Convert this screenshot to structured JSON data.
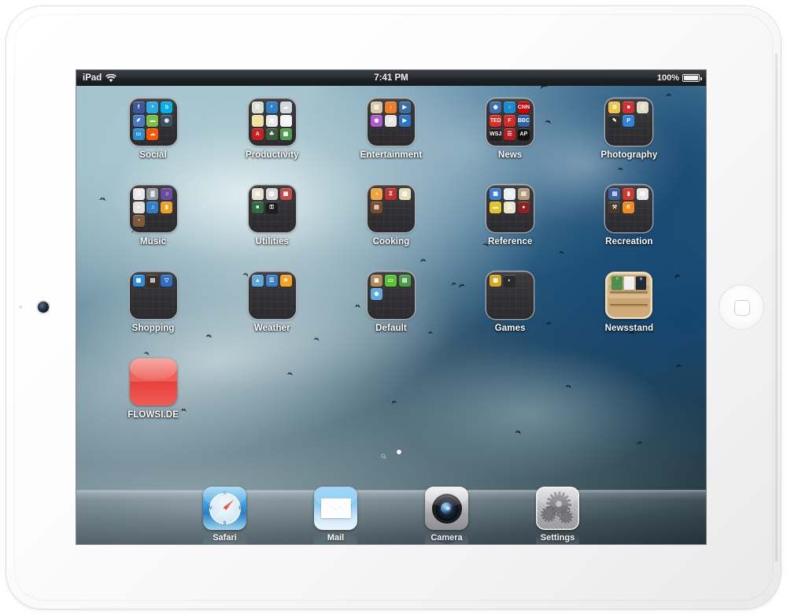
{
  "device": {
    "name": "iPad",
    "body_color": "#f7f7f8",
    "home_button": "home-button",
    "front_camera": "front-camera"
  },
  "status_bar": {
    "carrier": "iPad",
    "wifi_icon": "wifi-icon",
    "time": "7:41 PM",
    "battery_percent": "100%",
    "battery_icon": "battery-icon"
  },
  "home_screen": {
    "wallpaper_description": "sky-with-clouds-and-birds",
    "page_indicator": {
      "search_icon": "search-icon",
      "dots": 1,
      "active_index": 0
    },
    "apps": [
      {
        "label": "Social",
        "type": "folder",
        "mini_icons": [
          {
            "name": "facebook",
            "color": "#3b5998",
            "glyph": "f"
          },
          {
            "name": "twitter",
            "color": "#2daae1",
            "glyph": "ᵛ"
          },
          {
            "name": "skype",
            "color": "#00aff0",
            "glyph": "S"
          },
          {
            "name": "flipboard-social",
            "color": "#4a79c4",
            "glyph": "✐"
          },
          {
            "name": "whatsapp",
            "color": "#7ac043",
            "glyph": "▬"
          },
          {
            "name": "instagram",
            "color": "#3e5266",
            "glyph": "◉"
          },
          {
            "name": "linkedin",
            "color": "#2d8fd0",
            "glyph": "▭"
          },
          {
            "name": "soundcloud",
            "color": "#ff5500",
            "glyph": "☁"
          }
        ]
      },
      {
        "label": "Productivity",
        "type": "folder",
        "mini_icons": [
          {
            "name": "notes-green",
            "color": "#d8dfd2",
            "glyph": "☰"
          },
          {
            "name": "tweetbot",
            "color": "#2f7fc9",
            "glyph": "ᵛ"
          },
          {
            "name": "dropbox",
            "color": "#cfd8dd",
            "glyph": "☁"
          },
          {
            "name": "notepad-yellow",
            "color": "#f2e2a0",
            "glyph": ""
          },
          {
            "name": "pages",
            "color": "#e8e8e8",
            "glyph": "▤"
          },
          {
            "name": "calendar",
            "color": "#f4f4f4",
            "glyph": "3"
          },
          {
            "name": "adobe-reader",
            "color": "#cc1f1f",
            "glyph": "A"
          },
          {
            "name": "evernote",
            "color": "#3b5c3b",
            "glyph": "☘"
          },
          {
            "name": "numbers",
            "color": "#4f9e4f",
            "glyph": "▦"
          }
        ]
      },
      {
        "label": "Entertainment",
        "type": "folder",
        "mini_icons": [
          {
            "name": "tv-remote",
            "color": "#d5c9a5",
            "glyph": "▤"
          },
          {
            "name": "music-orange",
            "color": "#f07c28",
            "glyph": "♪"
          },
          {
            "name": "video-blue",
            "color": "#3d6f9e",
            "glyph": "▶"
          },
          {
            "name": "podcasts-purple",
            "color": "#b05ad0",
            "glyph": "◉"
          },
          {
            "name": "pandora",
            "color": "#e6e6e6",
            "glyph": "P"
          },
          {
            "name": "player-blue",
            "color": "#2c74c4",
            "glyph": "▶"
          }
        ]
      },
      {
        "label": "News",
        "type": "folder",
        "mini_icons": [
          {
            "name": "reeder",
            "color": "#3b6fa8",
            "glyph": "◉"
          },
          {
            "name": "instapaper",
            "color": "#1a8ad0",
            "glyph": "○"
          },
          {
            "name": "cnn",
            "color": "#cc0000",
            "glyph": "CNN"
          },
          {
            "name": "ted",
            "color": "#e62b1e",
            "glyph": "TED"
          },
          {
            "name": "flipboard",
            "color": "#d62a23",
            "glyph": "F"
          },
          {
            "name": "bbc-news",
            "color": "#2b62a8",
            "glyph": "BBC"
          },
          {
            "name": "wall-street-journal",
            "color": "#1f1f1f",
            "glyph": "WSJ"
          },
          {
            "name": "bbc-red",
            "color": "#b81b1b",
            "glyph": "☰"
          },
          {
            "name": "associated-press",
            "color": "#111111",
            "glyph": "AP"
          }
        ]
      },
      {
        "label": "Photography",
        "type": "folder",
        "mini_icons": [
          {
            "name": "camera-flower",
            "color": "#f0c14b",
            "glyph": "✿"
          },
          {
            "name": "photo-red",
            "color": "#d03030",
            "glyph": "■"
          },
          {
            "name": "color-splash",
            "color": "#e0dcc4",
            "glyph": "▒"
          },
          {
            "name": "snapseed",
            "color": "#2e2e2e",
            "glyph": "✎"
          },
          {
            "name": "photogene",
            "color": "#2f83d8",
            "glyph": "P"
          }
        ]
      },
      {
        "label": "Music",
        "type": "folder",
        "mini_icons": [
          {
            "name": "piano-keys",
            "color": "#e9e9e9",
            "glyph": "☰"
          },
          {
            "name": "synth-dark",
            "color": "#8f9aa5",
            "glyph": "▓"
          },
          {
            "name": "garageband-purple",
            "color": "#6b4b9e",
            "glyph": "♫"
          },
          {
            "name": "drum-white",
            "color": "#e0e0dc",
            "glyph": "●"
          },
          {
            "name": "music-blue",
            "color": "#2f7fc9",
            "glyph": "♫"
          },
          {
            "name": "orange-app",
            "color": "#f0a020",
            "glyph": "▮"
          },
          {
            "name": "metronome",
            "color": "#7d5a3a",
            "glyph": "◔"
          }
        ]
      },
      {
        "label": "Utilities",
        "type": "folder",
        "mini_icons": [
          {
            "name": "contacts-card",
            "color": "#e8e0cf",
            "glyph": "▤"
          },
          {
            "name": "files-grey",
            "color": "#d8d8d8",
            "glyph": "▧"
          },
          {
            "name": "calculator-red",
            "color": "#c44a4a",
            "glyph": "▦"
          },
          {
            "name": "terminal-green",
            "color": "#2f6b3f",
            "glyph": "■"
          },
          {
            "name": "1password",
            "color": "#1d1d1d",
            "glyph": "⚿"
          }
        ]
      },
      {
        "label": "Cooking",
        "type": "folder",
        "mini_icons": [
          {
            "name": "recipe-orange",
            "color": "#f2a33a",
            "glyph": "◑"
          },
          {
            "name": "cook-red",
            "color": "#c0302c",
            "glyph": "♖"
          },
          {
            "name": "cookbook-cream",
            "color": "#e8d9b8",
            "glyph": "▥"
          },
          {
            "name": "grill-brown",
            "color": "#7a4a2c",
            "glyph": "▤"
          }
        ]
      },
      {
        "label": "Reference",
        "type": "folder",
        "mini_icons": [
          {
            "name": "maps-blue",
            "color": "#3a7fd0",
            "glyph": "▦"
          },
          {
            "name": "wikipedia-globe",
            "color": "#e8f0f6",
            "glyph": "⌾"
          },
          {
            "name": "dictionary-brown",
            "color": "#b49a7a",
            "glyph": "▤"
          },
          {
            "name": "taxi-yellow",
            "color": "#e8c325",
            "glyph": "▬"
          },
          {
            "name": "notes-cream",
            "color": "#ece3c8",
            "glyph": "☰"
          },
          {
            "name": "imdb-red",
            "color": "#8a2222",
            "glyph": "●"
          }
        ]
      },
      {
        "label": "Recreation",
        "type": "folder",
        "mini_icons": [
          {
            "name": "transit-blue",
            "color": "#3a5f9e",
            "glyph": "▤"
          },
          {
            "name": "sports-red",
            "color": "#d03a2c",
            "glyph": "▮"
          },
          {
            "name": "kindle-grey",
            "color": "#e6e6e6",
            "glyph": "▤"
          },
          {
            "name": "tools-brown",
            "color": "#4a3a2c",
            "glyph": "⚒"
          },
          {
            "name": "kayak-orange",
            "color": "#f08a20",
            "glyph": "K"
          }
        ]
      },
      {
        "label": "Shopping",
        "type": "folder",
        "mini_icons": [
          {
            "name": "app-store-blue",
            "color": "#2f8fd8",
            "glyph": "▦"
          },
          {
            "name": "wallet-dark",
            "color": "#3a3126",
            "glyph": "▤"
          },
          {
            "name": "ebay-blue",
            "color": "#2f6fc4",
            "glyph": "▽"
          }
        ]
      },
      {
        "label": "Weather",
        "type": "folder",
        "mini_icons": [
          {
            "name": "weather-photo",
            "color": "#5fa8d8",
            "glyph": "▲"
          },
          {
            "name": "forecast-blue",
            "color": "#3f7fc8",
            "glyph": "☰"
          },
          {
            "name": "sun-orange",
            "color": "#f4a21f",
            "glyph": "☀"
          }
        ]
      },
      {
        "label": "Default",
        "type": "folder",
        "mini_icons": [
          {
            "name": "contacts-brown",
            "color": "#b08a5a",
            "glyph": "▣"
          },
          {
            "name": "messages-green",
            "color": "#5bc236",
            "glyph": "▭"
          },
          {
            "name": "maps-green",
            "color": "#4a9e4a",
            "glyph": "▤"
          },
          {
            "name": "game-center-blue",
            "color": "#5fa8e0",
            "glyph": "◉"
          }
        ]
      },
      {
        "label": "Games",
        "type": "folder",
        "mini_icons": [
          {
            "name": "puzzle-gold",
            "color": "#d8a820",
            "glyph": "▦"
          },
          {
            "name": "arcade-dark",
            "color": "#2a2a2a",
            "glyph": "◐"
          }
        ]
      },
      {
        "label": "Newsstand",
        "type": "newsstand",
        "shelf_items": [
          {
            "name": "magazine-green",
            "color": "#4a8f4a",
            "glyph": "☰"
          },
          {
            "name": "magazine-white",
            "color": "#f0f0f0",
            "glyph": "▤"
          },
          {
            "name": "magazine-dark",
            "color": "#1f2a3a",
            "glyph": "▧"
          }
        ]
      },
      {
        "label": "FLOWSI.DE",
        "type": "app",
        "icon": "flowsi-red-icon",
        "color": "#ee5148"
      }
    ]
  },
  "dock": {
    "items": [
      {
        "label": "Safari",
        "icon": "safari-compass-icon"
      },
      {
        "label": "Mail",
        "icon": "mail-envelope-icon"
      },
      {
        "label": "Camera",
        "icon": "camera-lens-icon"
      },
      {
        "label": "Settings",
        "icon": "settings-gears-icon"
      }
    ]
  }
}
